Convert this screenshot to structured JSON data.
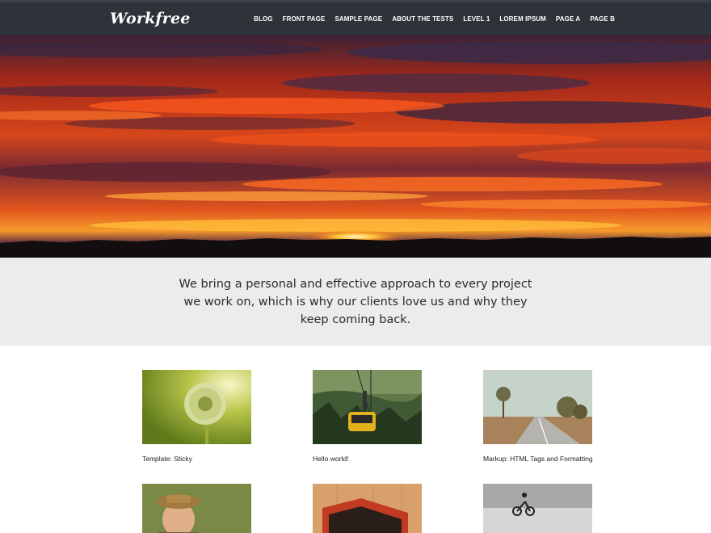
{
  "site": {
    "logo": "Workfree"
  },
  "nav": {
    "items": [
      {
        "label": "BLOG"
      },
      {
        "label": "FRONT PAGE"
      },
      {
        "label": "SAMPLE PAGE"
      },
      {
        "label": "ABOUT THE TESTS"
      },
      {
        "label": "LEVEL 1"
      },
      {
        "label": "LOREM IPSUM"
      },
      {
        "label": "PAGE A"
      },
      {
        "label": "PAGE B"
      }
    ]
  },
  "hero": {
    "image": "sunset-over-treeline"
  },
  "intro": {
    "line1": "We bring a personal and effective approach to every project",
    "line2": "we work on, which is why our clients love us and why they",
    "line3": "keep coming back."
  },
  "posts": [
    {
      "title": "Template: Sticky",
      "image": "dandelion-seed-head"
    },
    {
      "title": "Hello world!",
      "image": "cable-car-over-forest"
    },
    {
      "title": "Markup: HTML Tags and Formatting",
      "image": "empty-road-with-trees"
    },
    {
      "title": "",
      "image": "old-man-with-hat"
    },
    {
      "title": "",
      "image": "red-leather-wallet"
    },
    {
      "title": "",
      "image": "bmx-rider-jumping"
    }
  ],
  "colors": {
    "header_bg": "#2d3338",
    "band_bg": "#ececec",
    "text": "#2b2b2b"
  }
}
